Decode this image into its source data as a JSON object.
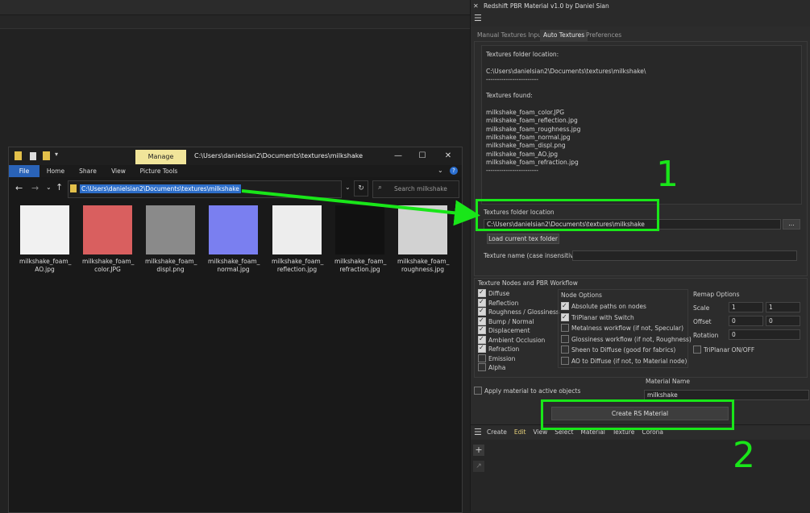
{
  "explorer": {
    "ribbon_manage": "Manage",
    "title_path": "C:\\Users\\danielsian2\\Documents\\textures\\milkshake",
    "controls": {
      "minimize": "—",
      "maximize": "☐",
      "close": "✕"
    },
    "ribbon_tabs": [
      "File",
      "Home",
      "Share",
      "View",
      "Picture Tools"
    ],
    "address": "C:\\Users\\danielsian2\\Documents\\textures\\milkshake",
    "search_placeholder": "Search milkshake",
    "files": [
      {
        "name": "milkshake_foam_\nAO.jpg",
        "color": "#f1f1f1"
      },
      {
        "name": "milkshake_foam_\ncolor.JPG",
        "color": "#d95f5f"
      },
      {
        "name": "milkshake_foam_\ndispl.png",
        "color": "#8a8a8a"
      },
      {
        "name": "milkshake_foam_\nnormal.jpg",
        "color": "#7a7ff0"
      },
      {
        "name": "milkshake_foam_\nreflection.jpg",
        "color": "#ededed"
      },
      {
        "name": "milkshake_foam_\nrefraction.jpg",
        "color": "#111111"
      },
      {
        "name": "milkshake_foam_\nroughness.jpg",
        "color": "#d2d2d2"
      }
    ]
  },
  "panel": {
    "title": "Redshift PBR Material v1.0 by Daniel Sian",
    "tabs": [
      "Manual Textures Input",
      "Auto Textures",
      "Preferences"
    ],
    "log": "Textures folder location:\n\nC:\\Users\\danielsian2\\Documents\\textures\\milkshake\\\n------------------------\n\nTextures found:\n\nmilkshake_foam_color.JPG\nmilkshake_foam_reflection.jpg\nmilkshake_foam_roughness.jpg\nmilkshake_foam_normal.jpg\nmilkshake_foam_displ.png\nmilkshake_foam_AO.jpg\nmilkshake_foam_refraction.jpg\n------------------------",
    "folder_group_label": "Textures folder location",
    "folder_path": "C:\\Users\\danielsian2\\Documents\\textures\\milkshake",
    "browse_label": "...",
    "load_button": "Load current tex folder",
    "texture_name_label": "Texture name (case insensitive):",
    "workflow_label": "Texture Nodes and PBR Workflow",
    "texture_nodes": [
      {
        "label": "Diffuse",
        "checked": true
      },
      {
        "label": "Reflection",
        "checked": true
      },
      {
        "label": "Roughness / Glossiness",
        "checked": true
      },
      {
        "label": "Bump / Normal",
        "checked": true
      },
      {
        "label": "Displacement",
        "checked": true
      },
      {
        "label": "Ambient Occlusion",
        "checked": true
      },
      {
        "label": "Refraction",
        "checked": true
      },
      {
        "label": "Emission",
        "checked": false
      },
      {
        "label": "Alpha",
        "checked": false
      }
    ],
    "node_options_label": "Node Options",
    "node_options": [
      {
        "label": "Absolute paths on nodes",
        "checked": true
      },
      {
        "label": "TriPlanar with Switch",
        "checked": true
      },
      {
        "label": "Metalness workflow (if not, Specular)",
        "checked": false
      },
      {
        "label": "Glossiness workflow (if not, Roughness)",
        "checked": false
      },
      {
        "label": "Sheen to Diffuse (good for fabrics)",
        "checked": false
      },
      {
        "label": "AO to Diffuse (if not, to Material node)",
        "checked": false
      }
    ],
    "remap_label": "Remap Options",
    "remap": {
      "scale_label": "Scale",
      "scale_a": "1",
      "scale_b": "1",
      "offset_label": "Offset",
      "offset_a": "0",
      "offset_b": "0",
      "rotation_label": "Rotation",
      "rotation": "0"
    },
    "triplanar_onoff": "TriPlanar ON/OFF",
    "apply_label": "Apply material to active objects",
    "material_name_label": "Material Name",
    "material_name": "milkshake",
    "create_button": "Create RS Material",
    "bottom_menu": [
      "Create",
      "Edit",
      "View",
      "Select",
      "Material",
      "Texture",
      "Corona"
    ]
  },
  "annotations": {
    "step1": "1",
    "step2": "2"
  },
  "colors": {
    "annotation": "#19e619",
    "accent": "#2d6ec9",
    "manage_tab": "#f1e59a"
  }
}
